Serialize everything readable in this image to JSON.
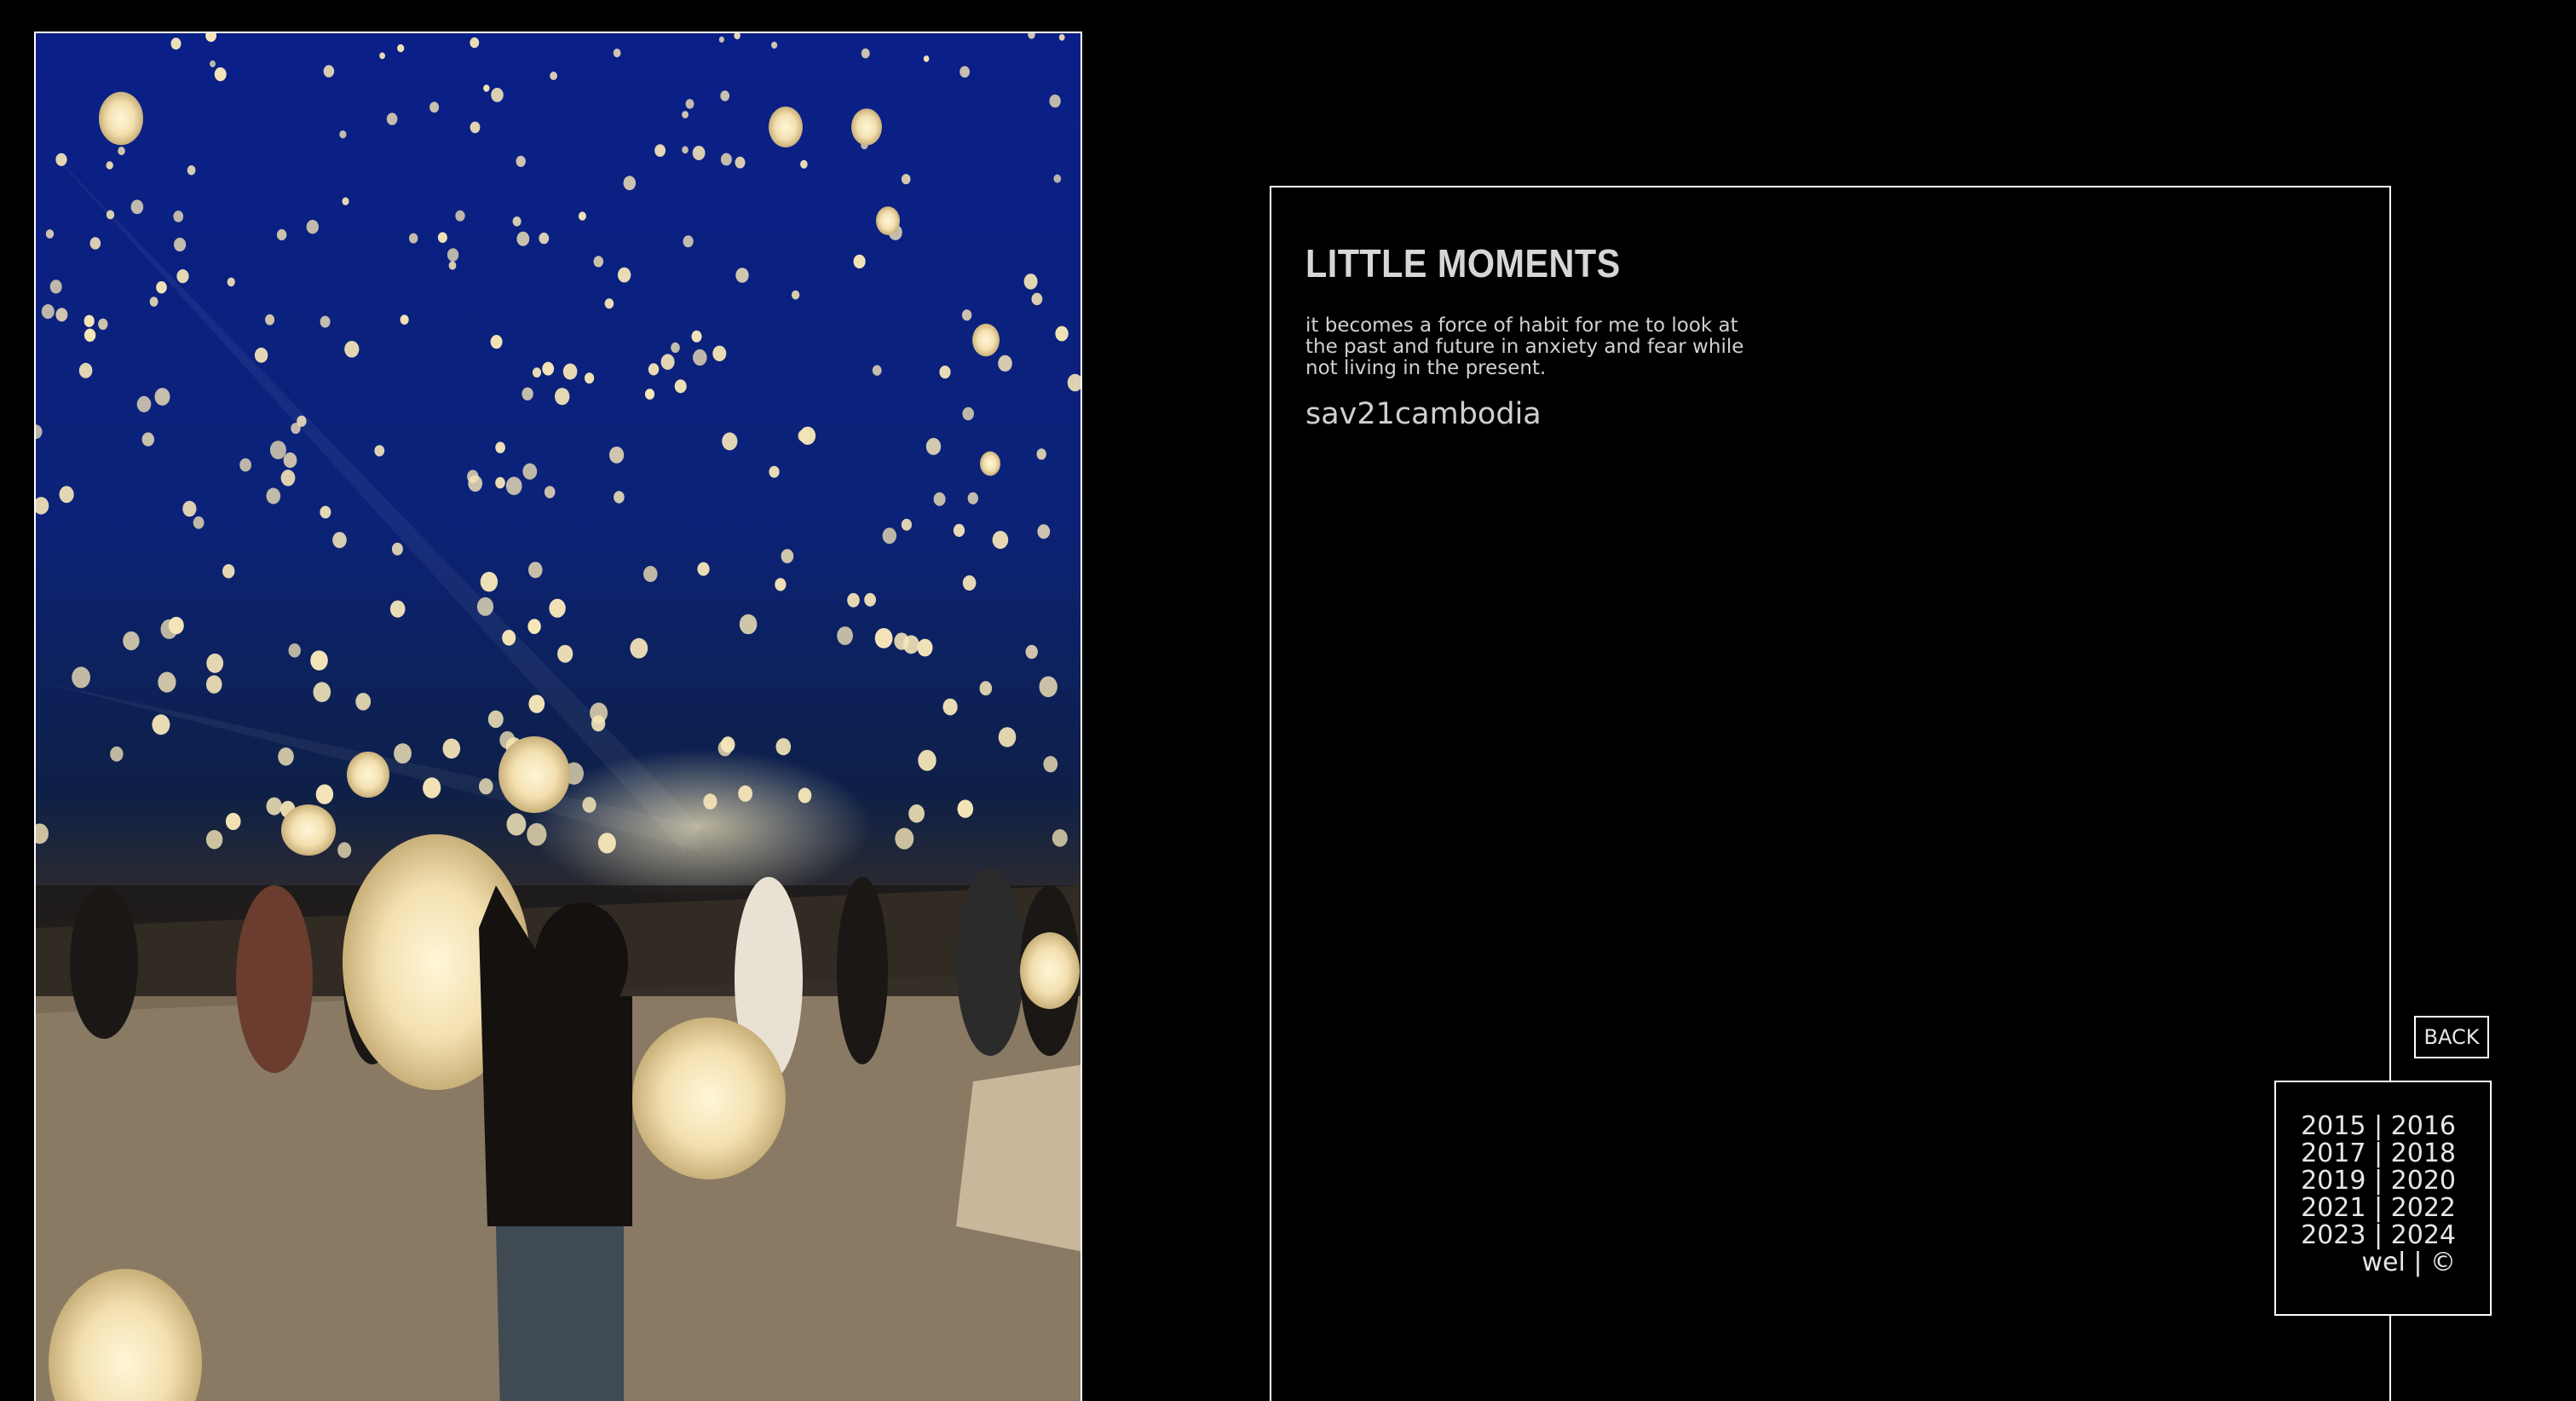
{
  "post": {
    "title": "LITTLE MOMENTS",
    "description": "it becomes a force of habit for me to look at the past and future in anxiety and fear while not living in the present.",
    "tag": "sav21cambodia"
  },
  "photo": {
    "subject": "sky lanterns released at night over a crowd"
  },
  "back_button": {
    "label": "BACK"
  },
  "year_nav": {
    "separator": "|",
    "rows": [
      {
        "left": "2015",
        "right": "2016"
      },
      {
        "left": "2017",
        "right": "2018"
      },
      {
        "left": "2019",
        "right": "2020"
      },
      {
        "left": "2021",
        "right": "2022"
      },
      {
        "left": "2023",
        "right": "2024"
      },
      {
        "left": "wel",
        "right": "©"
      }
    ]
  },
  "colors": {
    "background": "#000000",
    "border": "#ffffff",
    "text": "#d6d6d6"
  }
}
